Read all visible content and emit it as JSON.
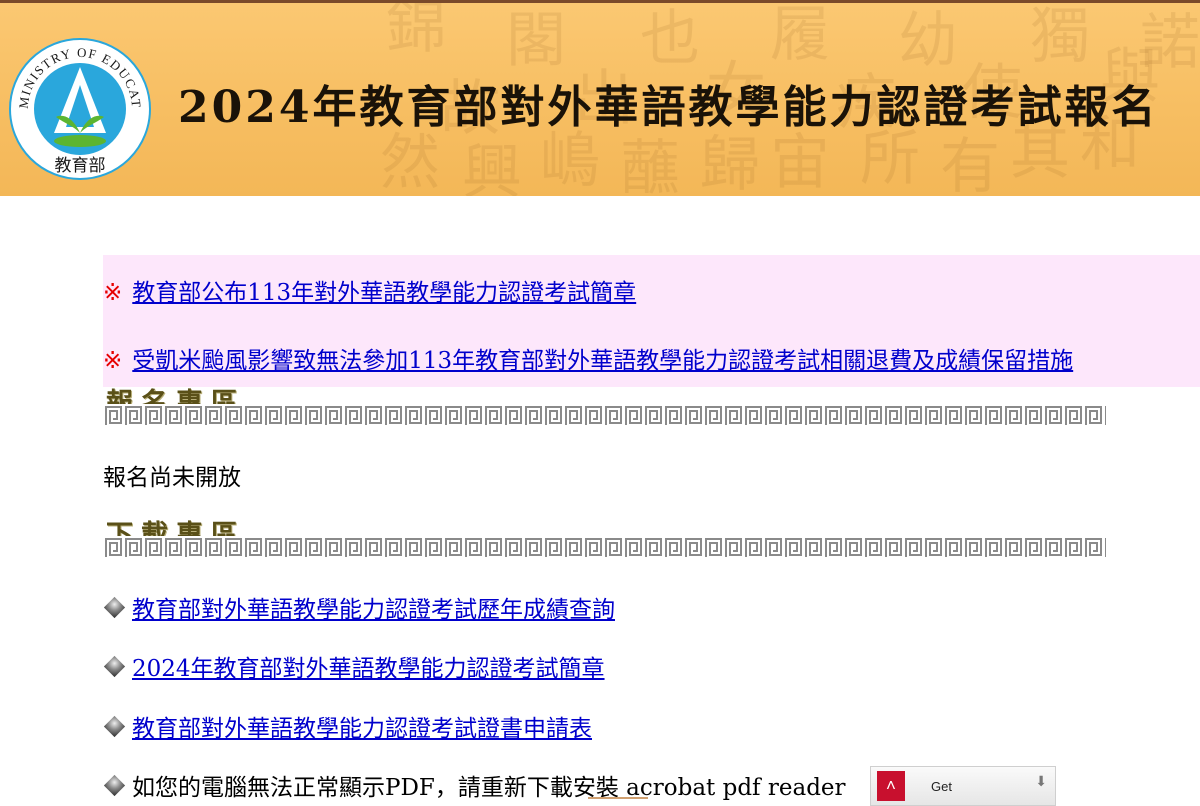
{
  "banner": {
    "title": "2024年教育部對外華語教學能力認證考試報名",
    "logo": {
      "ring_text": "MINISTRY OF EDUCATION",
      "chinese_name": "教育部",
      "colors": {
        "blue": "#2aa7dc",
        "green": "#5cb531"
      }
    },
    "background_glyphs": [
      "錦",
      "故",
      "閣",
      "出",
      "也",
      "女",
      "履",
      "疾",
      "幼",
      "使",
      "獨",
      "與",
      "然",
      "興",
      "嶋",
      "蘸",
      "歸",
      "宙",
      "所",
      "有",
      "其",
      "和",
      "諾"
    ]
  },
  "notices": [
    {
      "marker": "※",
      "text": "教育部公布113年對外華語教學能力認證考試簡章"
    },
    {
      "marker": "※",
      "text": "受凱米颱風影響致無法參加113年教育部對外華語教學能力認證考試相關退費及成績保留措施"
    }
  ],
  "registration": {
    "title": "報名專區",
    "status": "報名尚未開放"
  },
  "downloads": {
    "title": "下載專區",
    "items": [
      {
        "text": "教育部對外華語教學能力認證考試歷年成績查詢"
      },
      {
        "text": "2024年教育部對外華語教學能力認證考試簡章"
      },
      {
        "text": "教育部對外華語教學能力認證考試證書申請表"
      }
    ]
  },
  "pdf_notice": {
    "text": "如您的電腦無法正常顯示PDF，請重新下載安裝 acrobat pdf reader",
    "button_label": "Get",
    "icon": "adobe-reader-icon"
  },
  "colors": {
    "banner": "#f7be62",
    "notice_bg": "#fde7fb",
    "link": "#0000cc",
    "marker": "#e60000",
    "section_title": "#5a5018"
  }
}
